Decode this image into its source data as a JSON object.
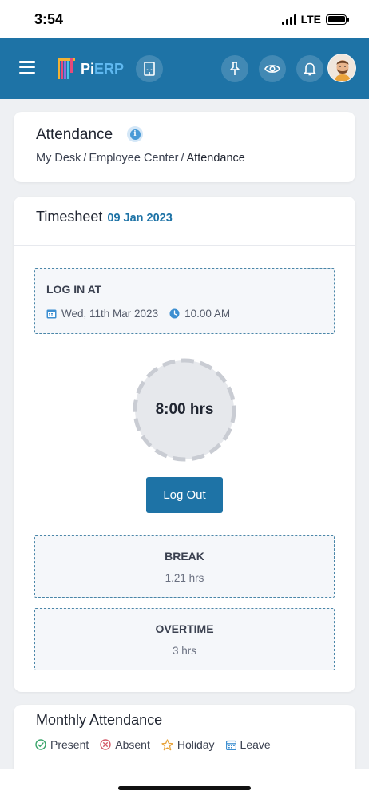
{
  "status_bar": {
    "time": "3:54",
    "network": "LTE"
  },
  "navbar": {
    "logo_pi": "Pi",
    "logo_erp": "ERP",
    "colors": {
      "primary": "#1e73a6",
      "logo_accent": "#5fb8f0"
    }
  },
  "header_card": {
    "title": "Attendance",
    "breadcrumb": [
      "My Desk",
      "Employee Center",
      "Attendance"
    ]
  },
  "timesheet": {
    "title": "Timesheet",
    "date": "09 Jan 2023",
    "login": {
      "label": "LOG IN AT",
      "date": "Wed, 11th Mar 2023",
      "time": "10.00 AM"
    },
    "hours": "8:00 hrs",
    "logout_label": "Log Out",
    "break": {
      "label": "BREAK",
      "value": "1.21 hrs"
    },
    "overtime": {
      "label": "OVERTIME",
      "value": "3 hrs"
    }
  },
  "monthly": {
    "title": "Monthly Attendance",
    "legend": [
      {
        "label": "Present",
        "icon": "check-circle-icon",
        "color": "#3aa56b"
      },
      {
        "label": "Absent",
        "icon": "x-circle-icon",
        "color": "#d45a6a"
      },
      {
        "label": "Holiday",
        "icon": "star-icon",
        "color": "#e8a33a"
      },
      {
        "label": "Leave",
        "icon": "calendar-icon",
        "color": "#3d8fd1"
      }
    ]
  }
}
